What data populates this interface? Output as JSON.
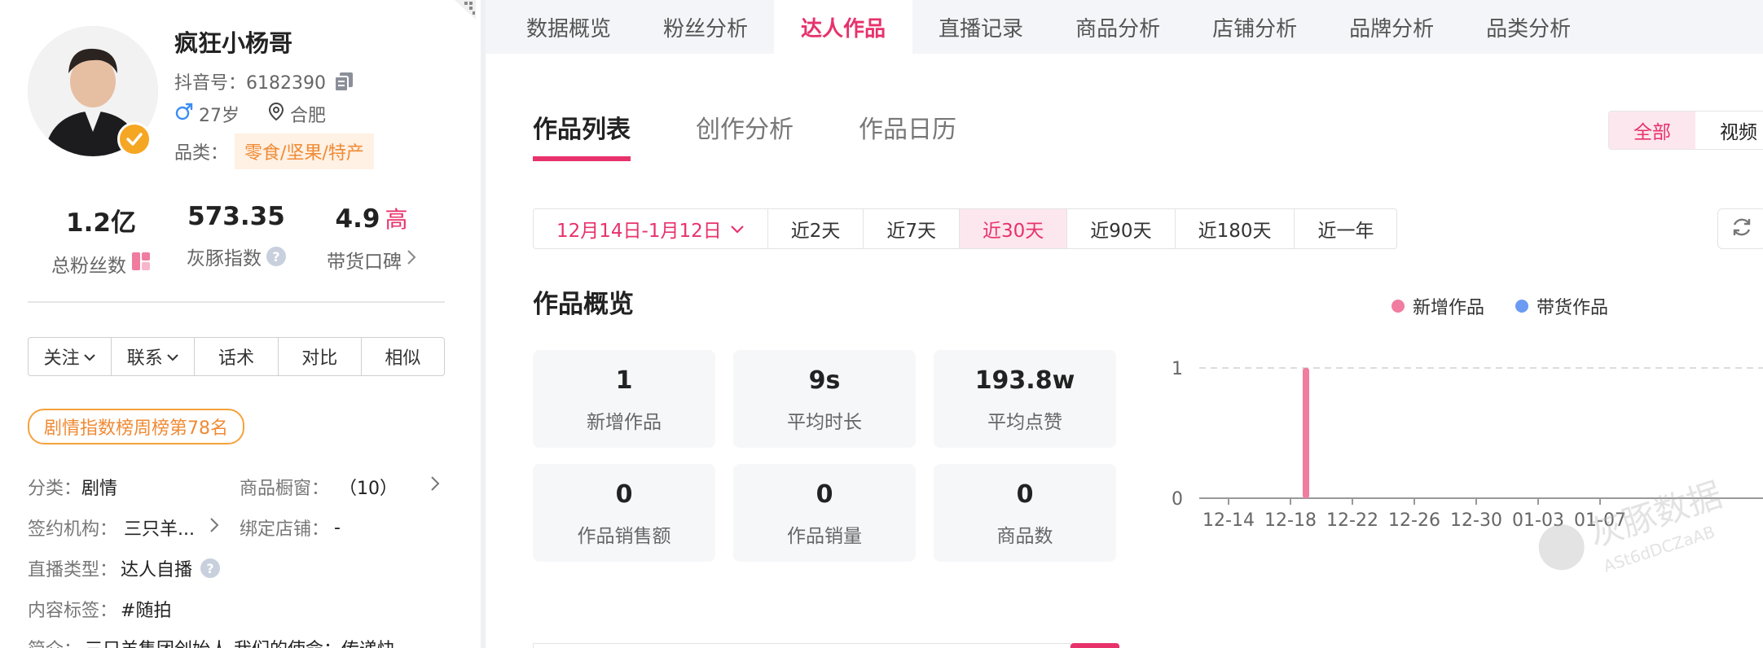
{
  "profile": {
    "name": "疯狂小杨哥",
    "douyin_id": "抖音号：6182390",
    "age": "27岁",
    "location": "合肥",
    "category_label": "品类：",
    "category": "零食/坚果/特产"
  },
  "stats": [
    {
      "value": "1.2亿",
      "label": "总粉丝数"
    },
    {
      "value": "573.35",
      "label": "灰豚指数"
    },
    {
      "value": "4.9",
      "level": "高",
      "label": "带货口碑"
    }
  ],
  "actions": [
    "关注",
    "联系",
    "话术",
    "对比",
    "相似"
  ],
  "rank_badge": "剧情指数榜周榜第78名",
  "info": {
    "category_k": "分类：",
    "category_v": "剧情",
    "window_k": "商品橱窗：",
    "window_v": "（10）",
    "agency_k": "签约机构：",
    "agency_v": "三只羊...",
    "shop_k": "绑定店铺：",
    "shop_v": "-",
    "live_k": "直播类型：",
    "live_v": "达人自播",
    "tags_k": "内容标签：",
    "tags_v": "#随拍",
    "intro_k": "简介：",
    "intro_v": "三只羊集团创始人 我们的使命：传递快"
  },
  "nav": {
    "tabs": [
      "数据概览",
      "粉丝分析",
      "达人作品",
      "直播记录",
      "商品分析",
      "店铺分析",
      "品牌分析",
      "品类分析"
    ],
    "active_index": 2
  },
  "subtabs": [
    "作品列表",
    "创作分析",
    "作品日历"
  ],
  "toggle": [
    "全部",
    "视频"
  ],
  "date_filter": {
    "range": "12月14日-1月12日",
    "options": [
      "近2天",
      "近7天",
      "近30天",
      "近90天",
      "近180天",
      "近一年"
    ],
    "active": "近30天"
  },
  "overview_title": "作品概览",
  "overview_cards": [
    {
      "value": "1",
      "label": "新增作品"
    },
    {
      "value": "9s",
      "label": "平均时长"
    },
    {
      "value": "193.8w",
      "label": "平均点赞"
    },
    {
      "value": "0",
      "label": "作品销售额"
    },
    {
      "value": "0",
      "label": "作品销量"
    },
    {
      "value": "0",
      "label": "商品数"
    }
  ],
  "colors": {
    "accent": "#e7326c",
    "new_works": "#f07ca0",
    "selling_works": "#6b9bf2",
    "orange": "#f08a34"
  },
  "chart_data": {
    "type": "bar",
    "series": [
      {
        "name": "新增作品",
        "points": [
          {
            "x": "12-19",
            "y": 1
          }
        ]
      },
      {
        "name": "带货作品",
        "points": []
      }
    ],
    "x_ticks": [
      "12-14",
      "12-18",
      "12-22",
      "12-26",
      "12-30",
      "01-03",
      "01-07"
    ],
    "y_ticks": [
      0,
      1
    ],
    "ylim": [
      0,
      1
    ]
  },
  "watermark": {
    "text": "灰豚数据",
    "sub": "ASt6dDCZaAB"
  }
}
